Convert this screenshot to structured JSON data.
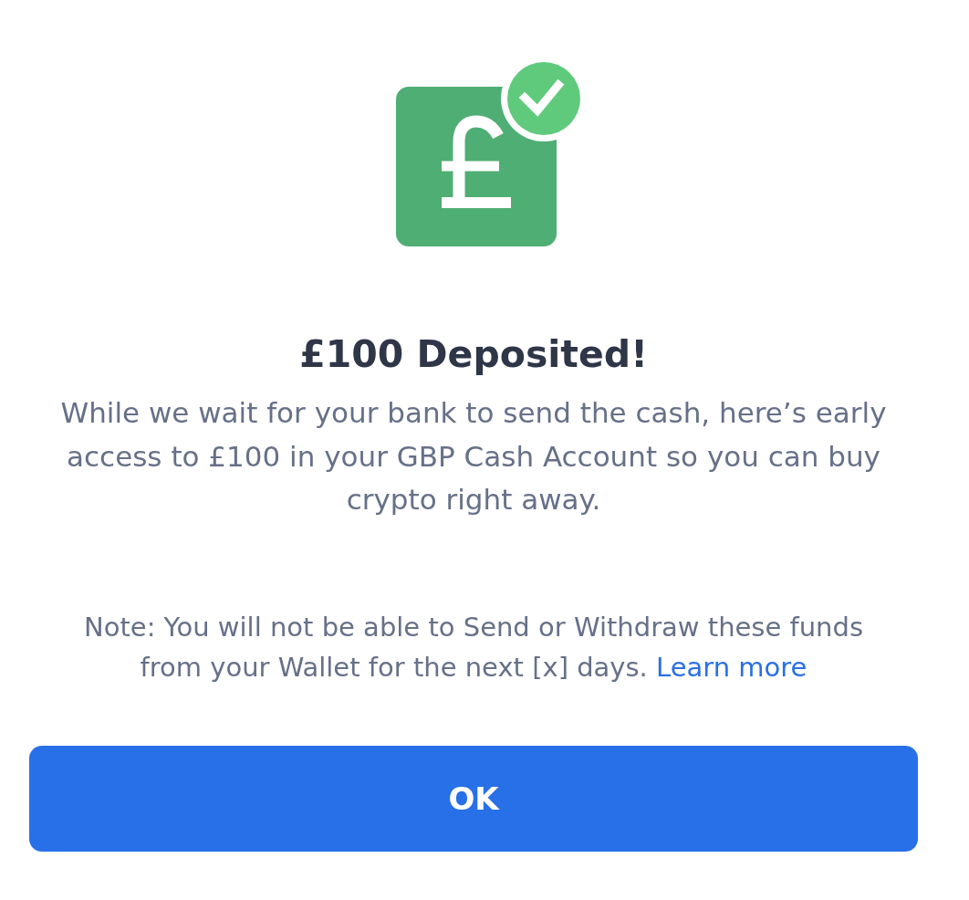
{
  "title": "£100 Deposited!",
  "message": "While we wait for your bank to send the cash, here’s early access to £100 in your GBP Cash Account so you can buy crypto right away.",
  "note": {
    "text": "Note: You will not be able to Send or Withdraw these funds from your Wallet for the next [x] days.",
    "link": "Learn more"
  },
  "button": {
    "label": "OK"
  }
}
